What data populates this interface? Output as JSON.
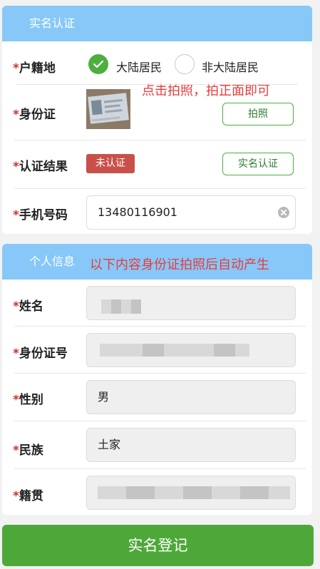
{
  "verify": {
    "section_title": "实名认证",
    "hukou": {
      "label": "户籍地",
      "options": [
        "大陆居民",
        "非大陆居民"
      ],
      "selected": "大陆居民"
    },
    "note_photo": "点击拍照，拍正面即可",
    "id_card": {
      "label": "身份证",
      "button": "拍照"
    },
    "result": {
      "label": "认证结果",
      "status": "未认证",
      "button": "实名认证"
    },
    "phone": {
      "label": "手机号码",
      "value": "13480116901"
    },
    "required_mark": "*"
  },
  "personal": {
    "section_title": "个人信息",
    "note_auto": "以下内容身份证拍照后自动产生",
    "name": {
      "label": "姓名"
    },
    "id_number": {
      "label": "身份证号"
    },
    "gender": {
      "label": "性别",
      "value": "男"
    },
    "ethnicity": {
      "label": "民族",
      "value": "土家"
    },
    "native_place": {
      "label": "籍贯"
    }
  },
  "submit": {
    "label": "实名登记"
  },
  "colors": {
    "header": "#87c8f8",
    "accent": "#4caf3e",
    "required": "#d0312d",
    "note": "#e83b3b",
    "badge": "#c9504a"
  }
}
